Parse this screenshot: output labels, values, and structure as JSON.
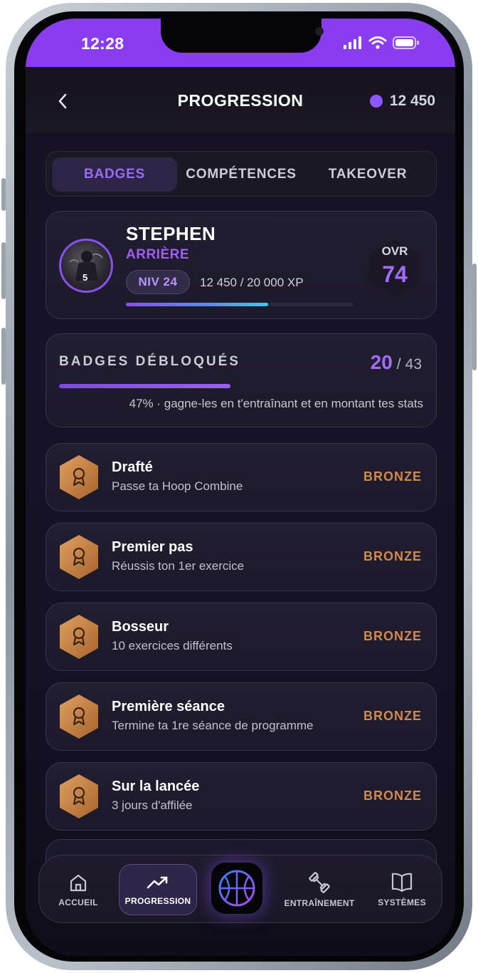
{
  "status_bar": {
    "time": "12:28",
    "signal_icon": "signal-icon",
    "wifi_icon": "wifi-icon",
    "battery_icon": "battery-icon"
  },
  "header": {
    "title": "PROGRESSION",
    "coins": "12 450",
    "back_icon": "chevron-left-icon"
  },
  "tabs": [
    {
      "label": "BADGES",
      "active": true
    },
    {
      "label": "COMPÉTENCES",
      "active": false
    },
    {
      "label": "TAKEOVER",
      "active": false
    }
  ],
  "player": {
    "name": "STEPHEN",
    "position": "ARRIÈRE",
    "level": "NIV 24",
    "xp": "12 450 / 20 000 XP",
    "xp_progress": 0.625,
    "ovr_label": "OVR",
    "ovr_value": "74",
    "jersey_number": "5"
  },
  "unlocked": {
    "title": "BADGES DÉBLOQUÉS",
    "count": "20",
    "slash": "/",
    "total": "43",
    "progress": 0.47,
    "hint": "47% · gagne-les en t'entraînant et en montant tes stats"
  },
  "badges": [
    {
      "name": "Drafté",
      "description": "Passe ta Hoop Combine",
      "tier": "BRONZE"
    },
    {
      "name": "Premier pas",
      "description": "Réussis ton 1er exercice",
      "tier": "BRONZE"
    },
    {
      "name": "Bosseur",
      "description": "10 exercices différents",
      "tier": "BRONZE"
    },
    {
      "name": "Première séance",
      "description": "Termine ta 1re séance de programme",
      "tier": "BRONZE"
    },
    {
      "name": "Sur la lancée",
      "description": "3 jours d'affilée",
      "tier": "BRONZE"
    }
  ],
  "nav": {
    "items": [
      {
        "label": "ACCUEIL",
        "icon": "home-icon",
        "active": false
      },
      {
        "label": "PROGRESSION",
        "icon": "trending-up-icon",
        "active": true
      },
      {
        "label": "ENTRAÎNEMENT",
        "icon": "dumbbell-icon",
        "active": false
      },
      {
        "label": "SYSTÈMES",
        "icon": "book-icon",
        "active": false
      }
    ],
    "center_icon": "basketball-icon"
  },
  "colors": {
    "accent": "#8a3cf0",
    "accent_text": "#a36cf8",
    "bronze": "#cf8a4e",
    "background": "#15121f"
  }
}
